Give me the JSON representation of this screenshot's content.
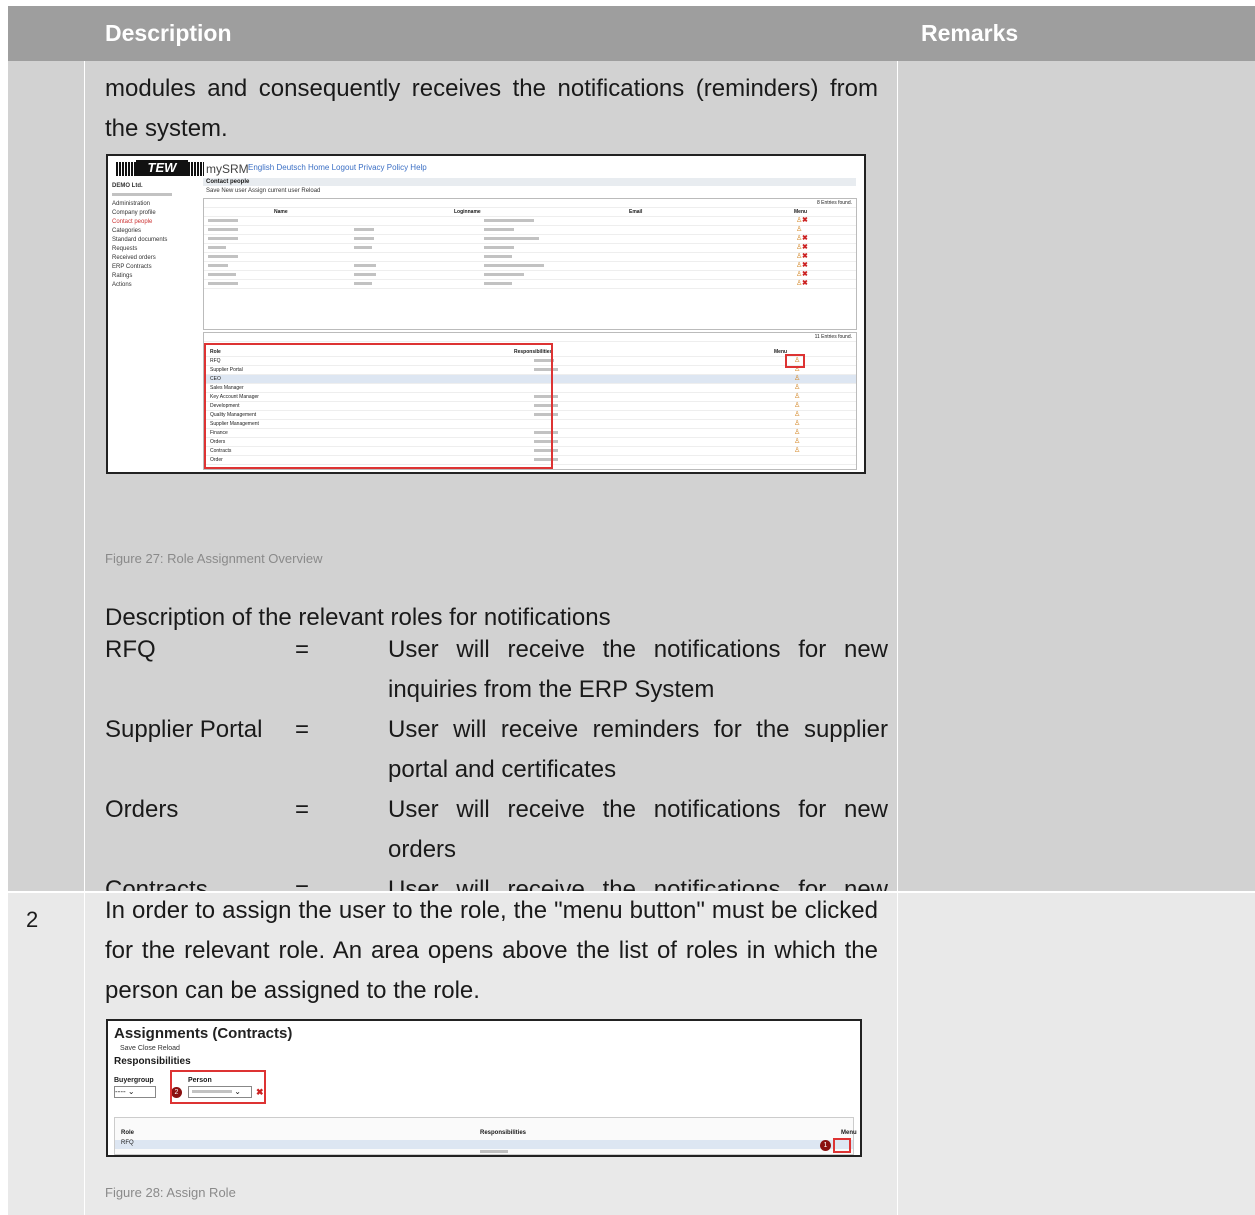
{
  "header": {
    "description": "Description",
    "remarks": "Remarks"
  },
  "row1": {
    "intro": "modules and consequently receives the notifications (reminders) from the system.",
    "figure_caption": "Figure 27: Role Assignment Overview",
    "roles_intro": "Description of the relevant roles for notifications",
    "roles": [
      {
        "key": "RFQ",
        "eq": "=",
        "value": "User will receive the notifications for new inquiries from the ERP System"
      },
      {
        "key": "Supplier Portal",
        "eq": "=",
        "value": "User will receive reminders for the supplier portal and certificates"
      },
      {
        "key": "Orders",
        "eq": "=",
        "value": "User will receive the notifications for new orders"
      },
      {
        "key": "Contracts",
        "eq": "=",
        "value": "User will receive the notifications for new blanket orders / contracts"
      }
    ]
  },
  "row2": {
    "number": "2",
    "text": "In order to assign the user to the role, the \"menu button\" must be clicked for the relevant role. An area opens above the list of roles in which the person can be assigned to the role.",
    "figure_caption": "Figure 28: Assign Role"
  },
  "shot1": {
    "logo": "TEW",
    "brand": "mySRM",
    "top_links": "English  Deutsch     Home  Logout  Privacy Policy  Help",
    "company": "DEMO Ltd.",
    "sidebar": [
      "Administration",
      "Company profile",
      "Contact people",
      "Categories",
      "Standard documents",
      "Requests",
      "Received orders",
      "ERP Contracts",
      "Ratings",
      "Actions"
    ],
    "panel_title": "Contact people",
    "toolbar": "Save   New user   Assign current user   Reload",
    "entries_top": "8 Entries found.",
    "contact_headers": [
      "Name",
      "Loginname",
      "Email",
      "Menu"
    ],
    "entries_bottom": "11 Entries found.",
    "role_headers": [
      "Role",
      "Responsibilities",
      "Menu"
    ],
    "roles": [
      "RFQ",
      "Supplier Portal",
      "CEO",
      "Sales Manager",
      "Key Account Manager",
      "Development",
      "Quality Management",
      "Supplier Management",
      "Finance",
      "Orders",
      "Contracts",
      "Order"
    ]
  },
  "shot2": {
    "title": "Assignments (Contracts)",
    "toolbar": "Save   Close   Reload",
    "responsibilities": "Responsibilities",
    "buyergroup_label": "Buyergroup",
    "buyergroup_value": "----",
    "person_label": "Person",
    "role_header": "Role",
    "resp_header": "Responsibilities",
    "menu_header": "Menu",
    "role_value": "RFQ",
    "badge1": "1",
    "badge2": "2"
  }
}
